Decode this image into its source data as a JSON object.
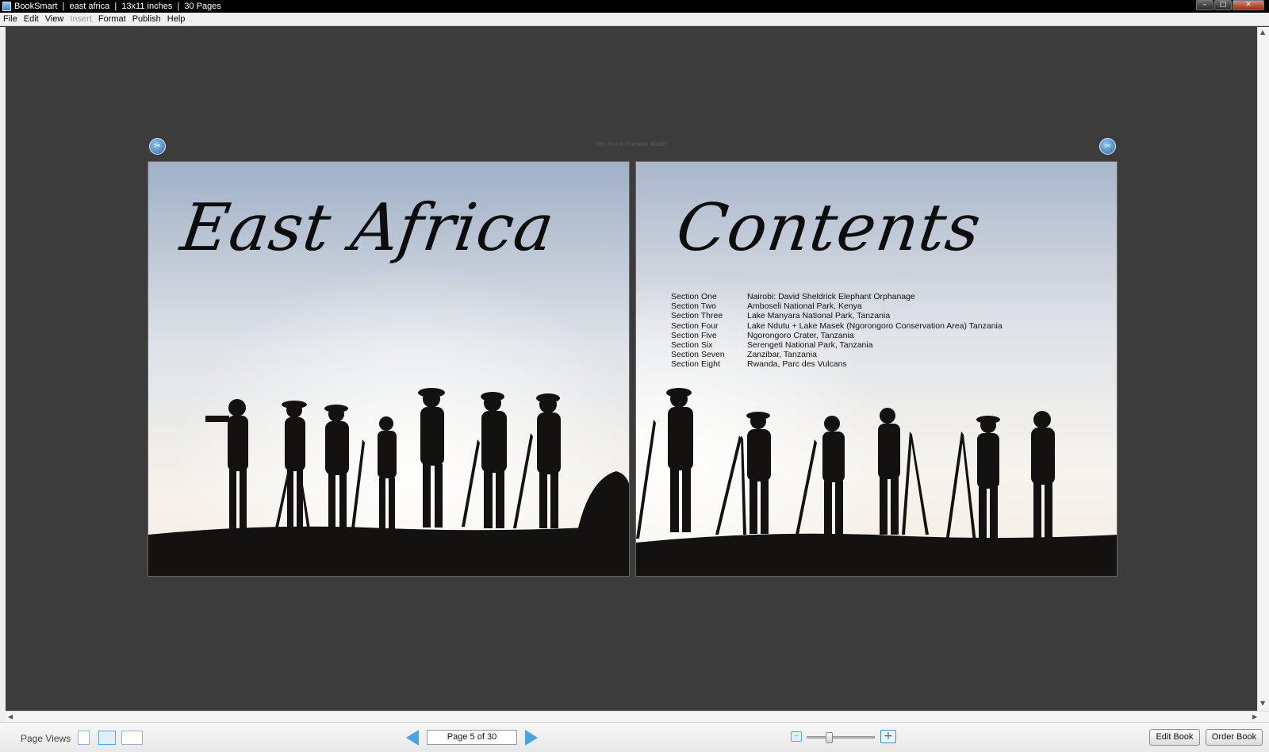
{
  "window": {
    "title": "BookSmart  |  east africa  |  13x11 inches  |  30 Pages",
    "controls": {
      "minimize": "–",
      "maximize": "□",
      "close": "✕"
    }
  },
  "menu": [
    {
      "label": "File",
      "disabled": false
    },
    {
      "label": "Edit",
      "disabled": false
    },
    {
      "label": "View",
      "disabled": false
    },
    {
      "label": "Insert",
      "disabled": true
    },
    {
      "label": "Format",
      "disabled": false
    },
    {
      "label": "Publish",
      "disabled": false
    },
    {
      "label": "Help",
      "disabled": false
    }
  ],
  "preview": {
    "mode_label": "You Are in Preview Mode",
    "left_page": {
      "title": "East Africa"
    },
    "right_page": {
      "title": "Contents",
      "toc": [
        {
          "section": "Section One",
          "title": "Nairobi: David Sheldrick Elephant Orphanage"
        },
        {
          "section": "Section Two",
          "title": "Amboseli National Park, Kenya"
        },
        {
          "section": "Section Three",
          "title": "Lake Manyara National Park, Tanzania"
        },
        {
          "section": "Section Four",
          "title": "Lake Ndutu + Lake Masek (Ngorongoro Conservation Area) Tanzania"
        },
        {
          "section": "Section Five",
          "title": "Ngorongoro Crater, Tanzania"
        },
        {
          "section": "Section Six",
          "title": "Serengeti National Park, Tanzania"
        },
        {
          "section": "Section Seven",
          "title": "Zanzibar, Tanzania"
        },
        {
          "section": "Section Eight",
          "title": "Rwanda, Parc des Vulcans"
        }
      ]
    }
  },
  "bottom_bar": {
    "page_views_label": "Page Views",
    "page_indicator": "Page 5 of 30",
    "zoom_level": 0.3,
    "edit_book_label": "Edit Book",
    "order_book_label": "Order Book"
  },
  "colors": {
    "workspace": "#3c3c3c",
    "accent_blue": "#49a4e4",
    "sky_top": "#a9b7cb",
    "sky_bottom": "#f3efe8",
    "silhouette": "#141210"
  }
}
